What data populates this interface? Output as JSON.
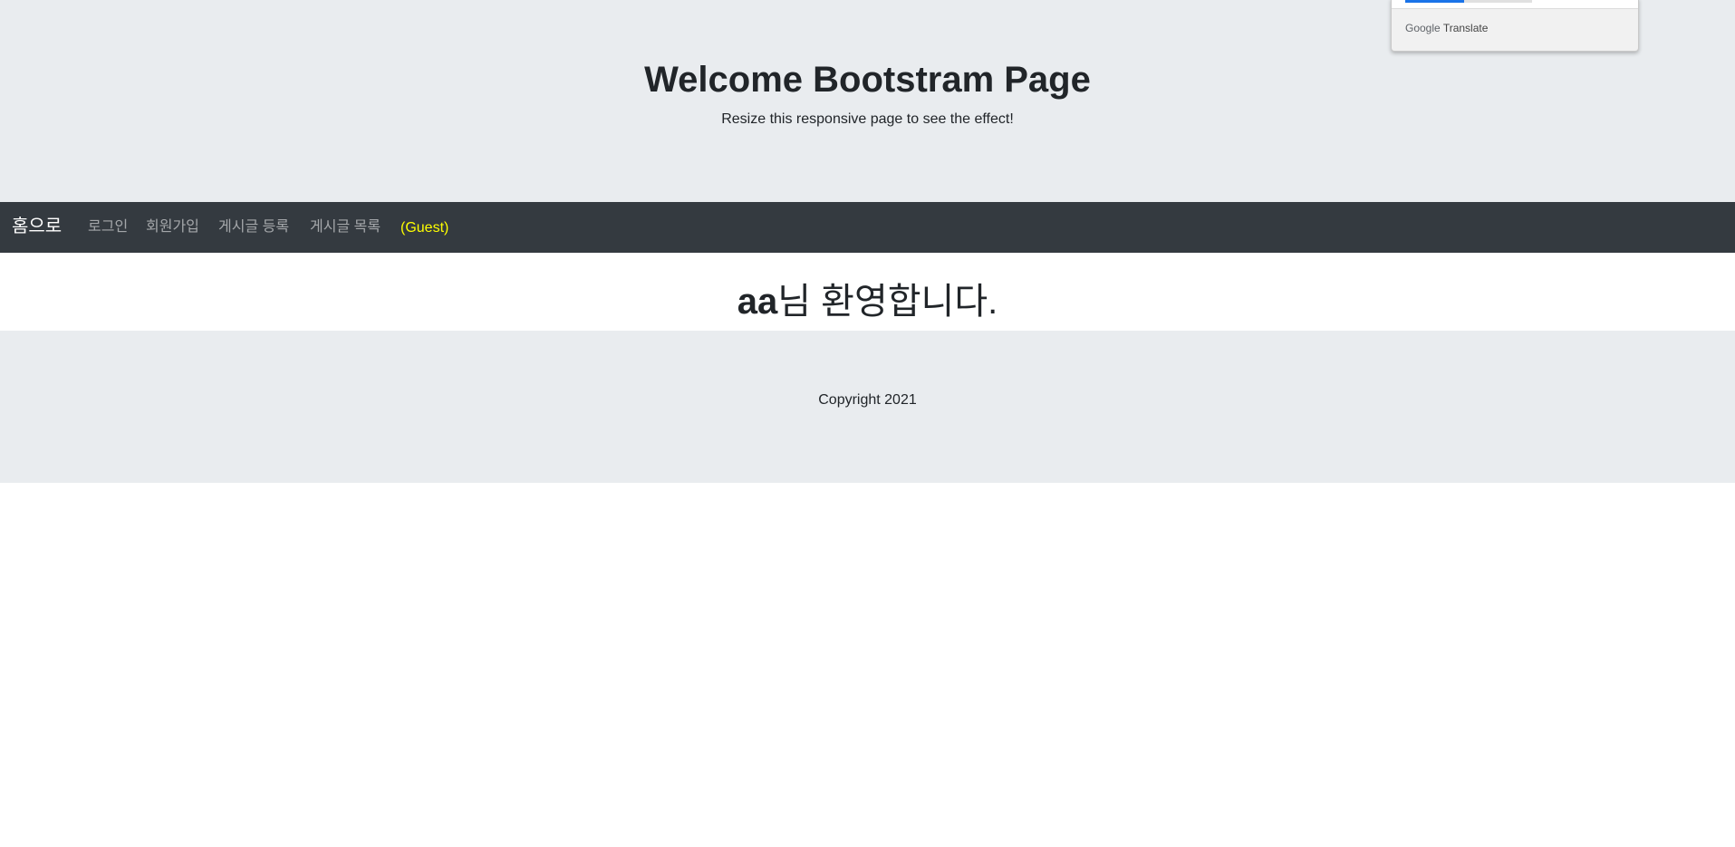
{
  "header": {
    "title": "Welcome Bootstram Page",
    "subtitle": "Resize this responsive page to see the effect!"
  },
  "translate_popup": {
    "brand_google": "Google",
    "brand_translate": "Translate"
  },
  "navbar": {
    "brand": "홈으로",
    "links": [
      "로그인",
      "회원가입",
      "게시글 등록",
      "게시글 목록"
    ],
    "user_status": "(Guest)"
  },
  "main": {
    "welcome_user": "aa",
    "welcome_text": "님 환영합니다."
  },
  "footer": {
    "copyright": "Copyright 2021"
  },
  "colors": {
    "jumbotron_bg": "#e9ecef",
    "navbar_bg": "#343a40",
    "guest_text": "#ffff00",
    "translate_accent": "#1a73e8"
  }
}
